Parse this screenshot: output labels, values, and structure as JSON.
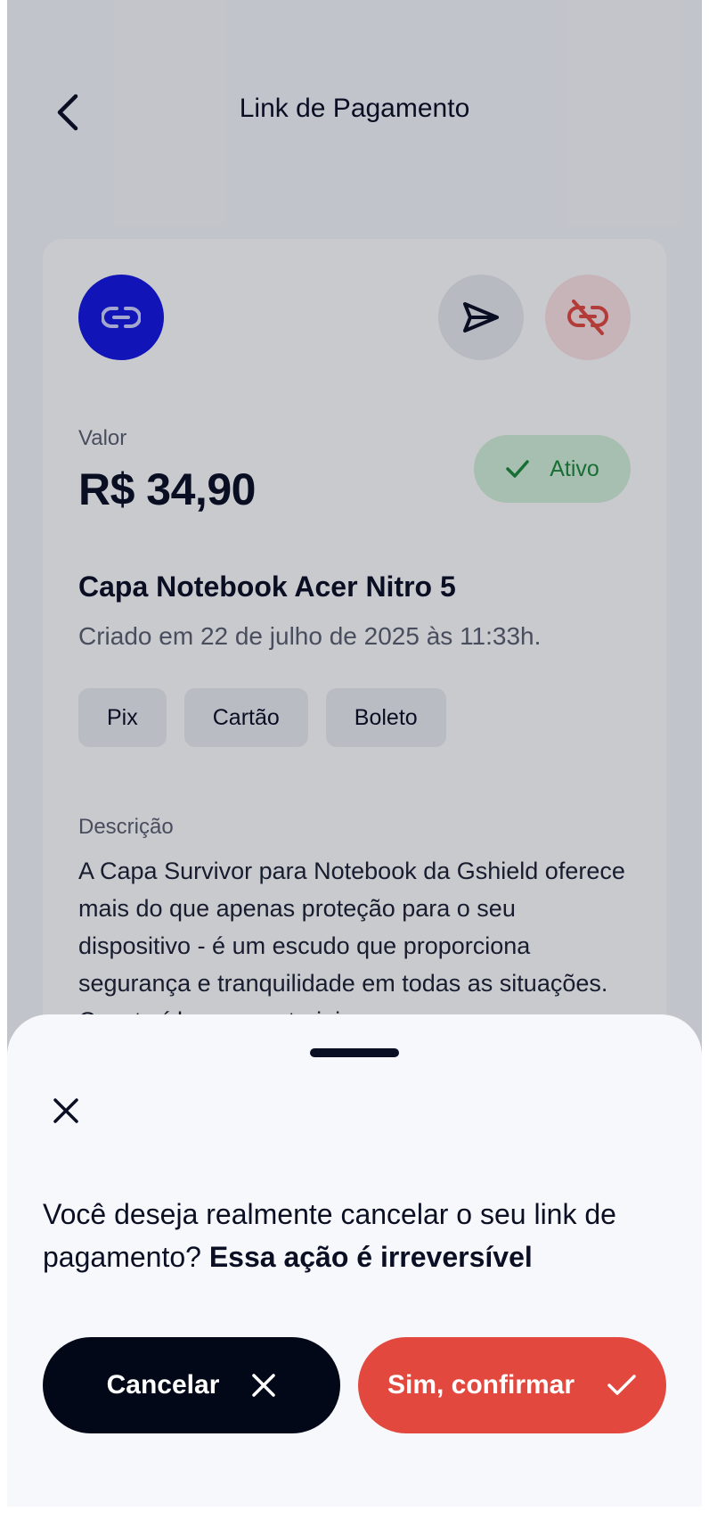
{
  "header": {
    "title": "Link de Pagamento"
  },
  "card": {
    "valor_label": "Valor",
    "valor_amount": "R$ 34,90",
    "status": "Ativo",
    "product_name": "Capa Notebook Acer Nitro 5",
    "created_date": "Criado em 22 de julho de 2025 às 11:33h.",
    "payment_methods": [
      "Pix",
      "Cartão",
      "Boleto"
    ],
    "description_label": "Descrição",
    "description_text": "A Capa Survivor para Notebook da Gshield oferece mais do que apenas proteção para o seu dispositivo - é um escudo que proporciona segurança e tranquilidade em todas as situações. Construída com materiais"
  },
  "sheet": {
    "message_regular": "Você deseja realmente cancelar o seu link de pagamento? ",
    "message_bold": "Essa ação é irreversível",
    "cancel_label": "Cancelar",
    "confirm_label": "Sim, confirmar"
  },
  "icons": {
    "back": "chevron-left-icon",
    "link": "link-icon",
    "send": "send-icon",
    "unlink": "link-off-icon",
    "status": "check-icon",
    "close": "close-icon",
    "cancel": "x-icon",
    "confirm": "check-icon"
  },
  "colors": {
    "primary": "#1416e0",
    "confirm": "#e3483f",
    "cancel": "#030818",
    "status_bg": "#d4f1d9",
    "status_text": "#1e8a3c"
  }
}
